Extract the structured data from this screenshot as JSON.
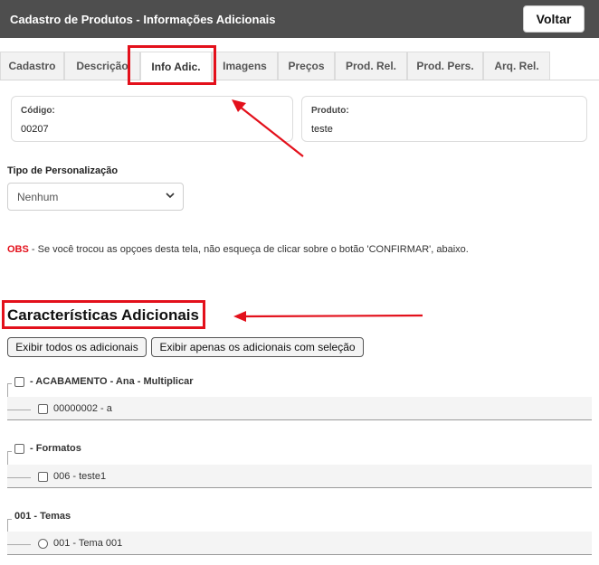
{
  "header": {
    "title": "Cadastro de Produtos - Informações Adicionais",
    "back_label": "Voltar"
  },
  "tabs": [
    {
      "label": "Cadastro"
    },
    {
      "label": "Descrição"
    },
    {
      "label": "Info Adic.",
      "active": true
    },
    {
      "label": "Imagens"
    },
    {
      "label": "Preços"
    },
    {
      "label": "Prod. Rel."
    },
    {
      "label": "Prod. Pers."
    },
    {
      "label": "Arq. Rel."
    }
  ],
  "form": {
    "codigo_label": "Código:",
    "codigo_value": "00207",
    "produto_label": "Produto:",
    "produto_value": "teste",
    "tipo_label": "Tipo de Personalização",
    "tipo_value": "Nenhum"
  },
  "obs": {
    "tag": "OBS",
    "text": " - Se você trocou as opçoes desta tela, não esqueça de clicar sobre o botão 'CONFIRMAR', abaixo."
  },
  "section": {
    "title": "Características Adicionais",
    "btn_all": "Exibir todos os adicionais",
    "btn_selected": "Exibir apenas os adicionais com seleção"
  },
  "groups": [
    {
      "label": "- ACABAMENTO - Ana - Multiplicar",
      "child": "00000002 - a"
    },
    {
      "label": "- Formatos",
      "child": "006 - teste1"
    },
    {
      "label": "001 - Temas",
      "child": "001 - Tema 001"
    }
  ],
  "colors": {
    "header_bg": "#4e4e4e",
    "highlight": "#e3101b"
  }
}
